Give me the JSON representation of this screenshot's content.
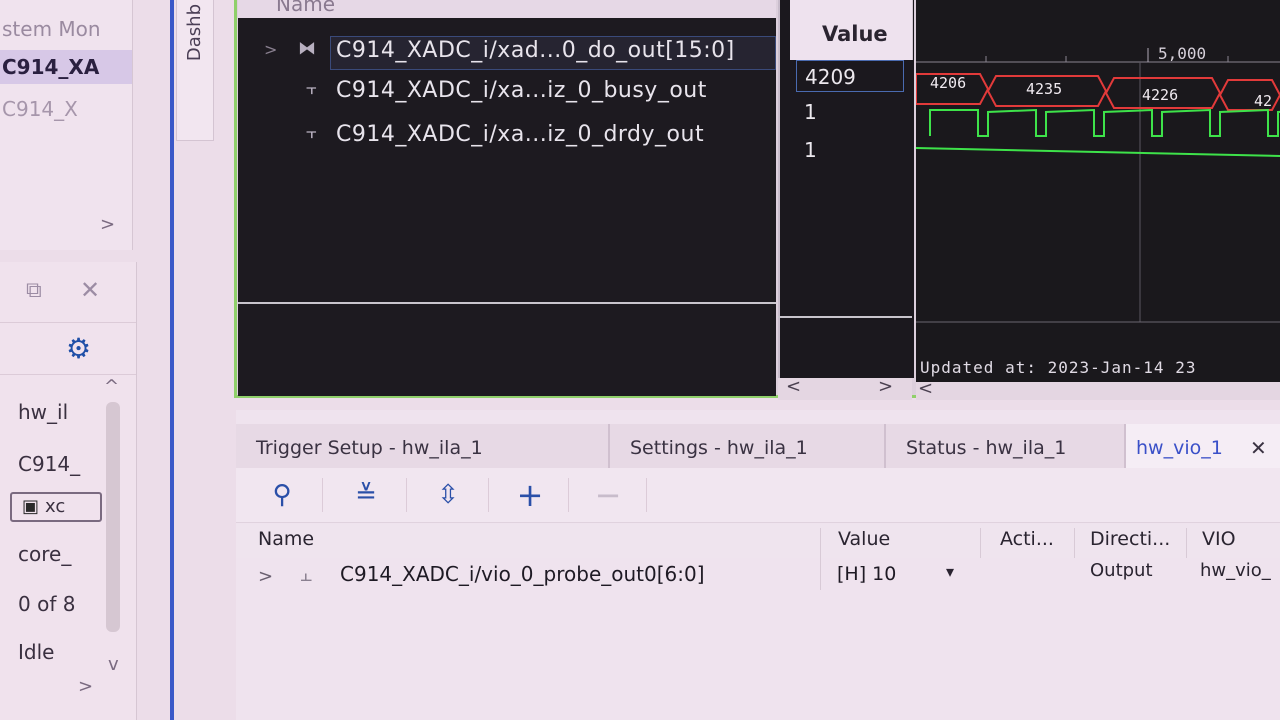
{
  "left_top": {
    "items": [
      "stem Mon",
      "C914_XA",
      "C914_X"
    ],
    "scroll_glyph": ">"
  },
  "left_bottom": {
    "restore_glyph": "⧉",
    "close_glyph": "✕",
    "gear_glyph": "⚙",
    "items": [
      "hw_il",
      "C914_",
      "xc",
      "core_",
      "0 of 8",
      "Idle"
    ],
    "up_glyph": "^",
    "down_glyph": "v",
    "right_glyph": ">"
  },
  "dashboard_tab": {
    "label": "Dashb"
  },
  "waveform": {
    "name_header": "Name",
    "value_header": "Value",
    "signals": [
      {
        "name": "C914_XADC_i/xad...0_do_out[15:0]",
        "value": "4209",
        "icon": "bus-icon"
      },
      {
        "name": "C914_XADC_i/xa...iz_0_busy_out",
        "value": "1",
        "icon": "bit-icon"
      },
      {
        "name": "C914_XADC_i/xa...iz_0_drdy_out",
        "value": "1",
        "icon": "bit-icon"
      }
    ],
    "timeline_label": "5,000",
    "bus_values": [
      "4206",
      "4235",
      "4226",
      "42"
    ],
    "updated_at": "Updated at: 2023-Jan-14 23",
    "scroll_left": "<",
    "scroll_right": ">",
    "colors": {
      "bus": "#e23a3a",
      "bit": "#3ee24a"
    }
  },
  "bottom": {
    "tabs": [
      {
        "label": "Trigger Setup - hw_ila_1"
      },
      {
        "label": "Settings - hw_ila_1"
      },
      {
        "label": "Status - hw_ila_1"
      },
      {
        "label": "hw_vio_1",
        "close": "✕"
      }
    ],
    "toolbar": {
      "search": "⚲",
      "collapse": "≚",
      "expand": "⇳",
      "add": "+",
      "remove": "−"
    },
    "table": {
      "headers": [
        "Name",
        "Value",
        "Acti...",
        "Directi...",
        "VIO"
      ],
      "rows": [
        {
          "expand": ">",
          "name": "C914_XADC_i/vio_0_probe_out0[6:0]",
          "value": "[H] 10",
          "caret": "▾",
          "action": "",
          "direction": "Output",
          "vio": "hw_vio_"
        }
      ]
    }
  }
}
